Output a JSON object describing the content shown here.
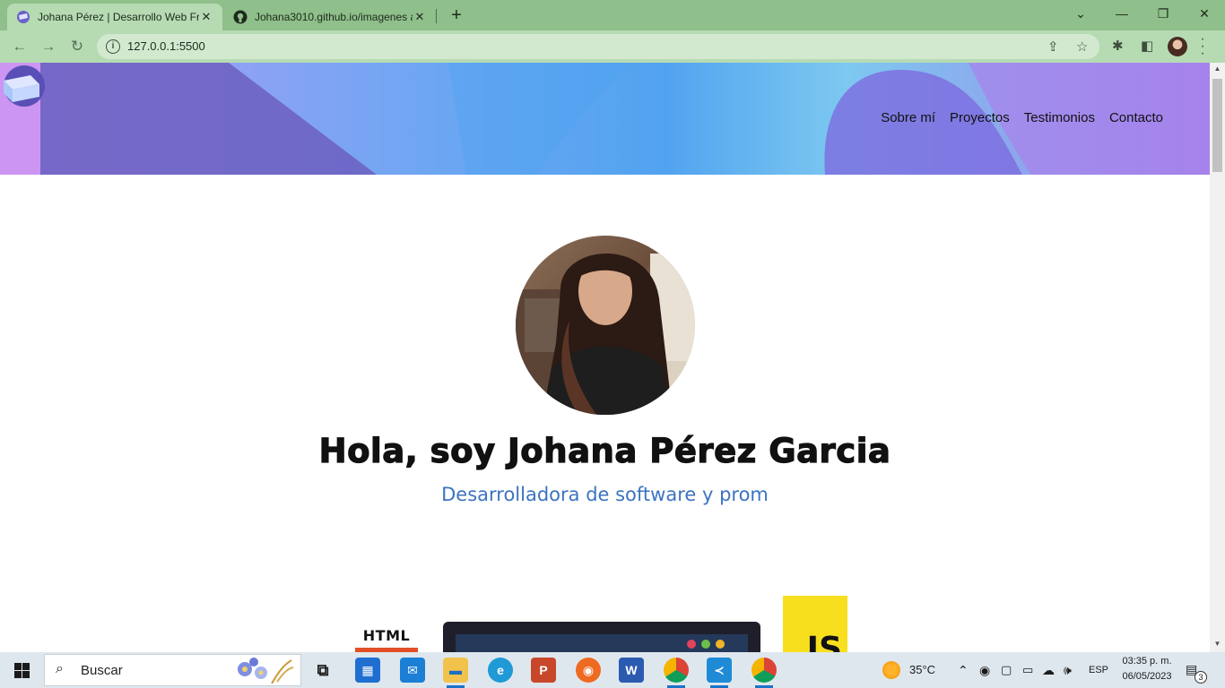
{
  "browser": {
    "tabs": [
      {
        "title": "Johana Pérez | Desarrollo Web Fr",
        "favicon": "portfolio-logo-icon",
        "active": true
      },
      {
        "title": "Johana3010.github.io/imagenes a",
        "favicon": "github-icon",
        "active": false
      }
    ],
    "url": "127.0.0.1:5500",
    "window_controls": [
      "chevron-down-icon",
      "minimize-icon",
      "restore-icon",
      "close-icon"
    ]
  },
  "page": {
    "nav": [
      "Sobre mí",
      "Proyectos",
      "Testimonios",
      "Contacto"
    ],
    "headline": "Hola, soy Johana Pérez Garcia",
    "subtitle": "Desarrolladora de software y prom",
    "skills": {
      "html": "HTML",
      "js": "JS"
    }
  },
  "taskbar": {
    "search_placeholder": "Buscar",
    "weather": "35°C",
    "language": "ESP",
    "time": "03:35 p. m.",
    "date": "06/05/2023",
    "notifications": "3"
  },
  "colors": {
    "tab_strip": "#8fbf8a",
    "toolbar": "#b6dbb3",
    "subtitle": "#3c73c0",
    "html_bar": "#e34f26",
    "js_yellow": "#f7df1e"
  }
}
